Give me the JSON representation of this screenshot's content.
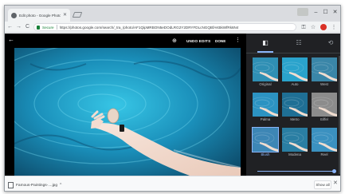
{
  "browser": {
    "tab_title": "Edit photo - Google Photos",
    "tab_close": "✕",
    "url_secure_label": "Secure",
    "url": "https://photos.google.com/search/_tra_/photo/AF1QipMRBON5eDOdLRG2Y2DRYFDLcNGQBfAKBkWfRk6N4",
    "window_buttons": {
      "minimize": "–",
      "maximize": "☐",
      "close": "✕"
    },
    "nav": {
      "back": "←",
      "forward": "→",
      "reload": "C"
    }
  },
  "editor": {
    "back": "←",
    "zoom": "⊕",
    "undo_label": "UNDO EDITS",
    "done_label": "DONE",
    "more": "⋮",
    "panel_tabs": [
      {
        "id": "color-filters",
        "icon": "◧",
        "active": true
      },
      {
        "id": "adjustments",
        "icon": "☷",
        "active": false
      },
      {
        "id": "crop-rotate",
        "icon": "⟲",
        "active": false
      }
    ],
    "filters": [
      {
        "label": "Original",
        "tint": "#2f8fb4",
        "selected": false
      },
      {
        "label": "Auto",
        "tint": "#2aa3cc",
        "selected": false
      },
      {
        "label": "West",
        "tint": "#3a86a8",
        "selected": false
      },
      {
        "label": "Palma",
        "tint": "#2c93c2",
        "selected": false
      },
      {
        "label": "Metro",
        "tint": "#1f6f95",
        "selected": false
      },
      {
        "label": "Eiffel",
        "tint": "#8c8c8c",
        "selected": false
      },
      {
        "label": "Blush",
        "tint": "#3d86b5",
        "selected": true
      },
      {
        "label": "Modena",
        "tint": "#2a7ea3",
        "selected": false
      },
      {
        "label": "Reel",
        "tint": "#3b91c0",
        "selected": false
      }
    ],
    "filter_intensity": 1.0
  },
  "downloads": {
    "file_name": "Famous-Paintings-....jpg",
    "caret": "^",
    "show_all": "Show all",
    "close": "✕"
  }
}
